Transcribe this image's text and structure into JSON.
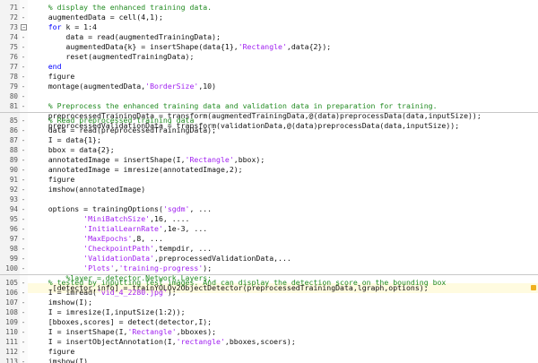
{
  "editor": {
    "block1": {
      "lines": [
        {
          "n": "71",
          "p": [
            {
              "t": "    "
            },
            {
              "t": "% display the enhanced training data.",
              "c": "cm"
            }
          ]
        },
        {
          "n": "72",
          "p": [
            {
              "t": "    augmentedData = cell(4,1);"
            }
          ]
        },
        {
          "n": "73",
          "fold": true,
          "p": [
            {
              "t": "    "
            },
            {
              "t": "for",
              "c": "kw"
            },
            {
              "t": " k = 1:4"
            }
          ]
        },
        {
          "n": "74",
          "p": [
            {
              "t": "        data = read(augmentedTrainingData);"
            }
          ]
        },
        {
          "n": "75",
          "p": [
            {
              "t": "        augmentedData{k} = insertShape(data{1},"
            },
            {
              "t": "'Rectangle'",
              "c": "st"
            },
            {
              "t": ",data{2});"
            }
          ]
        },
        {
          "n": "76",
          "p": [
            {
              "t": "        reset(augmentedTrainingData);"
            }
          ]
        },
        {
          "n": "77",
          "p": [
            {
              "t": "    "
            },
            {
              "t": "end",
              "c": "kw"
            }
          ]
        },
        {
          "n": "78",
          "p": [
            {
              "t": "    figure"
            }
          ]
        },
        {
          "n": "79",
          "p": [
            {
              "t": "    montage(augmentedData,"
            },
            {
              "t": "'BorderSize'",
              "c": "st"
            },
            {
              "t": ",10)"
            }
          ]
        },
        {
          "n": "80",
          "p": [
            {
              "t": ""
            }
          ]
        },
        {
          "n": "81",
          "p": [
            {
              "t": "    "
            },
            {
              "t": "% Preprocess the enhanced training data and validation data in preparation for training.",
              "c": "cm"
            }
          ]
        },
        {
          "n": "82",
          "p": [
            {
              "t": "    preprocessedTrainingData = transform(augmentedTrainingData,@(data)preprocessData(data,inputSize));"
            }
          ]
        },
        {
          "n": "83",
          "p": [
            {
              "t": "    preprocessedValidationData = transform(validationData,@(data)preprocessData(data,inputSize));"
            }
          ]
        }
      ]
    },
    "block2": {
      "lines": [
        {
          "n": "85",
          "p": [
            {
              "t": "    "
            },
            {
              "t": "% Read preprocessed training data",
              "c": "cm"
            }
          ]
        },
        {
          "n": "86",
          "p": [
            {
              "t": "    data = read(preprocessedTrainingData);"
            }
          ]
        },
        {
          "n": "87",
          "p": [
            {
              "t": "    I = data{1};"
            }
          ]
        },
        {
          "n": "88",
          "p": [
            {
              "t": "    bbox = data{2};"
            }
          ]
        },
        {
          "n": "89",
          "p": [
            {
              "t": "    annotatedImage = insertShape(I,"
            },
            {
              "t": "'Rectangle'",
              "c": "st"
            },
            {
              "t": ",bbox);"
            }
          ]
        },
        {
          "n": "90",
          "p": [
            {
              "t": "    annotatedImage = imresize(annotatedImage,2);"
            }
          ]
        },
        {
          "n": "91",
          "p": [
            {
              "t": "    figure"
            }
          ]
        },
        {
          "n": "92",
          "p": [
            {
              "t": "    imshow(annotatedImage)"
            }
          ]
        },
        {
          "n": "93",
          "p": [
            {
              "t": ""
            }
          ]
        },
        {
          "n": "94",
          "p": [
            {
              "t": "    options = trainingOptions("
            },
            {
              "t": "'sgdm'",
              "c": "st"
            },
            {
              "t": ", ..."
            }
          ]
        },
        {
          "n": "95",
          "p": [
            {
              "t": "            "
            },
            {
              "t": "'MiniBatchSize'",
              "c": "st"
            },
            {
              "t": ",16, ...."
            }
          ]
        },
        {
          "n": "96",
          "p": [
            {
              "t": "            "
            },
            {
              "t": "'InitialLearnRate'",
              "c": "st"
            },
            {
              "t": ",1e-3, ..."
            }
          ]
        },
        {
          "n": "97",
          "p": [
            {
              "t": "            "
            },
            {
              "t": "'MaxEpochs'",
              "c": "st"
            },
            {
              "t": ",8, ..."
            }
          ]
        },
        {
          "n": "98",
          "p": [
            {
              "t": "            "
            },
            {
              "t": "'CheckpointPath'",
              "c": "st"
            },
            {
              "t": ",tempdir, ..."
            }
          ]
        },
        {
          "n": "99",
          "p": [
            {
              "t": "            "
            },
            {
              "t": "'ValidationData'",
              "c": "st"
            },
            {
              "t": ",preprocessedValidationData,..."
            }
          ]
        },
        {
          "n": "100",
          "p": [
            {
              "t": "            "
            },
            {
              "t": "'Plots'",
              "c": "st"
            },
            {
              "t": ","
            },
            {
              "t": "'training-progress'",
              "c": "st"
            },
            {
              "t": ");"
            }
          ]
        },
        {
          "n": "101",
          "p": [
            {
              "t": "        "
            },
            {
              "t": "%layer = detector.Network.Layers;",
              "c": "cm"
            }
          ]
        },
        {
          "n": "102",
          "warn": true,
          "p": [
            {
              "t": "     [detector,info] = trainYOLOv2ObjectDetector(preprocessedTrainingData,lgraph,options);"
            }
          ]
        }
      ]
    },
    "block3": {
      "lines": [
        {
          "n": "105",
          "p": [
            {
              "t": "    "
            },
            {
              "t": "% tested by inputting test images. And can display the detection score on the bounding box",
              "c": "cm"
            }
          ]
        },
        {
          "n": "106",
          "p": [
            {
              "t": "    I = imread("
            },
            {
              "t": "'vid_4_2280.jpg'",
              "c": "st"
            },
            {
              "t": ");"
            }
          ]
        },
        {
          "n": "107",
          "p": [
            {
              "t": "    imshow(I);"
            }
          ]
        },
        {
          "n": "108",
          "p": [
            {
              "t": "    I = imresize(I,inputSize(1:2));"
            }
          ]
        },
        {
          "n": "109",
          "p": [
            {
              "t": "    [bboxes,scores] = detect(detector,I);"
            }
          ]
        },
        {
          "n": "110",
          "p": [
            {
              "t": "    I = insertShape(I,"
            },
            {
              "t": "'Rectangle'",
              "c": "st"
            },
            {
              "t": ",bboxes);"
            }
          ]
        },
        {
          "n": "111",
          "p": [
            {
              "t": "    I = insertObjectAnnotation(I,"
            },
            {
              "t": "'rectangle'",
              "c": "st"
            },
            {
              "t": ",bboxes,scoers);"
            }
          ]
        },
        {
          "n": "112",
          "p": [
            {
              "t": "    figure"
            }
          ]
        },
        {
          "n": "113",
          "p": [
            {
              "t": "    imshow(I)"
            }
          ]
        },
        {
          "n": "113",
          "p": [
            {
              "t": ""
            }
          ]
        }
      ]
    }
  }
}
